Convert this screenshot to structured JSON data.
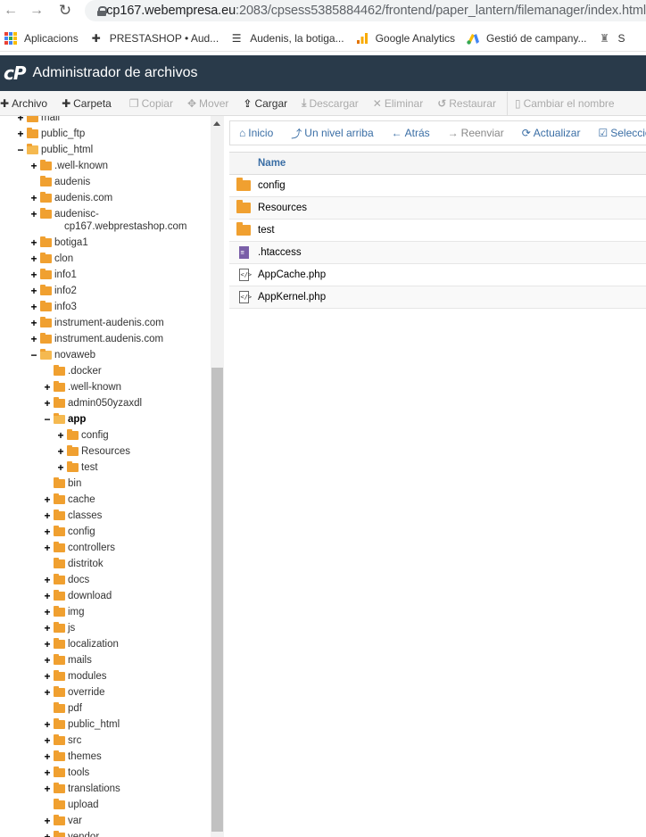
{
  "browser": {
    "url_host": "cp167.webempresa.eu",
    "url_rest": ":2083/cpsess5385884462/frontend/paper_lantern/filemanager/index.html",
    "bookmarks": [
      {
        "label": "Aplicacions",
        "icon": "apps-grid-icon"
      },
      {
        "label": "PRESTASHOP • Aud...",
        "icon": "prestashop-icon"
      },
      {
        "label": "Audenis, la botiga...",
        "icon": "audenis-icon"
      },
      {
        "label": "Google Analytics",
        "icon": "analytics-icon"
      },
      {
        "label": "Gestió de campany...",
        "icon": "google-ads-icon"
      },
      {
        "label": "S",
        "icon": "bookmark-icon"
      }
    ]
  },
  "header": {
    "logo": "cP",
    "title": "Administrador de archivos"
  },
  "toolbar": {
    "archivo": "Archivo",
    "carpeta": "Carpeta",
    "copiar": "Copiar",
    "mover": "Mover",
    "cargar": "Cargar",
    "descargar": "Descargar",
    "eliminar": "Eliminar",
    "restaurar": "Restaurar",
    "cambiar": "Cambiar el nombre"
  },
  "nav": {
    "inicio": "Inicio",
    "arriba": "Un nivel arriba",
    "atras": "Atrás",
    "reenviar": "Reenviar",
    "actualizar": "Actualizar",
    "seleccionar": "Seleccionar"
  },
  "table": {
    "header_name": "Name",
    "rows": [
      {
        "name": "config",
        "type": "folder"
      },
      {
        "name": "Resources",
        "type": "folder"
      },
      {
        "name": "test",
        "type": "folder"
      },
      {
        "name": ".htaccess",
        "type": "text"
      },
      {
        "name": "AppCache.php",
        "type": "php"
      },
      {
        "name": "AppKernel.php",
        "type": "php"
      }
    ]
  },
  "tree": [
    {
      "label": "mail",
      "toggle": "+",
      "level": 0
    },
    {
      "label": "public_ftp",
      "toggle": "+",
      "level": 0
    },
    {
      "label": "public_html",
      "toggle": "−",
      "level": 0,
      "open": true
    },
    {
      "label": ".well-known",
      "toggle": "+",
      "level": 1
    },
    {
      "label": "audenis",
      "toggle": "",
      "level": 1
    },
    {
      "label": "audenis.com",
      "toggle": "+",
      "level": 1
    },
    {
      "label": "audenisc-",
      "toggle": "+",
      "level": 1
    },
    {
      "label": "cp167.webprestashop.com",
      "toggle": "",
      "level": 1,
      "continuation": true
    },
    {
      "label": "botiga1",
      "toggle": "+",
      "level": 1
    },
    {
      "label": "clon",
      "toggle": "+",
      "level": 1
    },
    {
      "label": "info1",
      "toggle": "+",
      "level": 1
    },
    {
      "label": "info2",
      "toggle": "+",
      "level": 1
    },
    {
      "label": "info3",
      "toggle": "+",
      "level": 1
    },
    {
      "label": "instrument-audenis.com",
      "toggle": "+",
      "level": 1
    },
    {
      "label": "instrument.audenis.com",
      "toggle": "+",
      "level": 1
    },
    {
      "label": "novaweb",
      "toggle": "−",
      "level": 1,
      "open": true
    },
    {
      "label": ".docker",
      "toggle": "",
      "level": 2
    },
    {
      "label": ".well-known",
      "toggle": "+",
      "level": 2
    },
    {
      "label": "admin050yzaxdl",
      "toggle": "+",
      "level": 2
    },
    {
      "label": "app",
      "toggle": "−",
      "level": 2,
      "open": true,
      "bold": true
    },
    {
      "label": "config",
      "toggle": "+",
      "level": 3
    },
    {
      "label": "Resources",
      "toggle": "+",
      "level": 3
    },
    {
      "label": "test",
      "toggle": "+",
      "level": 3
    },
    {
      "label": "bin",
      "toggle": "",
      "level": 2
    },
    {
      "label": "cache",
      "toggle": "+",
      "level": 2
    },
    {
      "label": "classes",
      "toggle": "+",
      "level": 2
    },
    {
      "label": "config",
      "toggle": "+",
      "level": 2
    },
    {
      "label": "controllers",
      "toggle": "+",
      "level": 2
    },
    {
      "label": "distritok",
      "toggle": "",
      "level": 2
    },
    {
      "label": "docs",
      "toggle": "+",
      "level": 2
    },
    {
      "label": "download",
      "toggle": "+",
      "level": 2
    },
    {
      "label": "img",
      "toggle": "+",
      "level": 2
    },
    {
      "label": "js",
      "toggle": "+",
      "level": 2
    },
    {
      "label": "localization",
      "toggle": "+",
      "level": 2
    },
    {
      "label": "mails",
      "toggle": "+",
      "level": 2
    },
    {
      "label": "modules",
      "toggle": "+",
      "level": 2
    },
    {
      "label": "override",
      "toggle": "+",
      "level": 2
    },
    {
      "label": "pdf",
      "toggle": "",
      "level": 2
    },
    {
      "label": "public_html",
      "toggle": "+",
      "level": 2
    },
    {
      "label": "src",
      "toggle": "+",
      "level": 2
    },
    {
      "label": "themes",
      "toggle": "+",
      "level": 2
    },
    {
      "label": "tools",
      "toggle": "+",
      "level": 2
    },
    {
      "label": "translations",
      "toggle": "+",
      "level": 2
    },
    {
      "label": "upload",
      "toggle": "",
      "level": 2
    },
    {
      "label": "var",
      "toggle": "+",
      "level": 2
    },
    {
      "label": "vendor",
      "toggle": "+",
      "level": 2
    }
  ]
}
